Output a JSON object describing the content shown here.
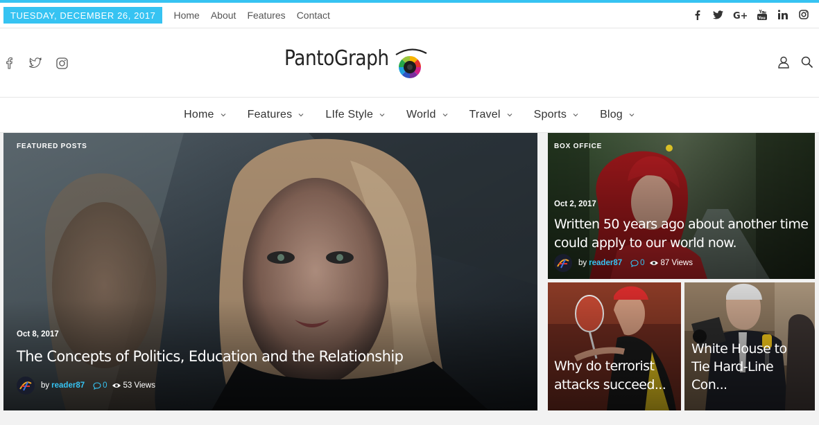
{
  "topbar": {
    "date": "TUESDAY, DECEMBER 26, 2017",
    "links": [
      "Home",
      "About",
      "Features",
      "Contact"
    ],
    "social_icons": [
      "facebook-icon",
      "twitter-icon",
      "google-plus-icon",
      "youtube-icon",
      "linkedin-icon",
      "instagram-icon"
    ]
  },
  "header": {
    "logo_text": "PantoGraph",
    "social_icons": [
      "facebook-icon",
      "twitter-icon",
      "instagram-icon"
    ],
    "right_icons": [
      "user-icon",
      "search-icon"
    ]
  },
  "nav": {
    "items": [
      "Home",
      "Features",
      "LIfe Style",
      "World",
      "Travel",
      "Sports",
      "Blog"
    ]
  },
  "featured": {
    "tag": "FEATURED POSTS",
    "date": "Oct 8, 2017",
    "title": "The Concepts of Politics, Education and the Relationship",
    "author_prefix": "by",
    "author": "reader87",
    "comments": "0",
    "views": "53 Views"
  },
  "box_office": {
    "tag": "BOX OFFICE",
    "date": "Oct 2, 2017",
    "title_line1": "Written 50 years ago about another time",
    "title_line2": "could apply to our world now.",
    "author_prefix": "by",
    "author": "reader87",
    "comments": "0",
    "views": "87 Views"
  },
  "tennis": {
    "title_line1": "Why do terrorist",
    "title_line2": "attacks succeed..."
  },
  "whitehouse": {
    "title_line1": "White House to",
    "title_line2": "Tie Hard-Line",
    "title_line3": "Con..."
  },
  "colors": {
    "accent": "#36c3f2",
    "text": "#222222"
  }
}
